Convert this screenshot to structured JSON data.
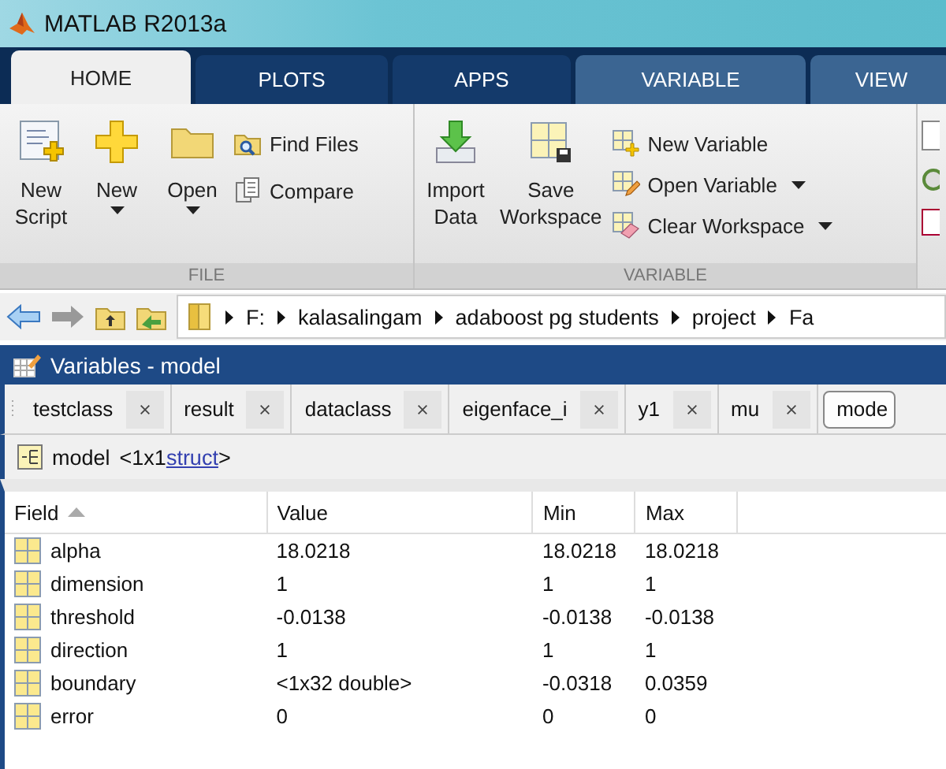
{
  "window": {
    "title": "MATLAB R2013a"
  },
  "tabs": [
    {
      "label": "HOME",
      "selected": true,
      "kind": "standard"
    },
    {
      "label": "PLOTS",
      "selected": false,
      "kind": "standard"
    },
    {
      "label": "APPS",
      "selected": false,
      "kind": "standard"
    },
    {
      "label": "VARIABLE",
      "selected": false,
      "kind": "contextual"
    },
    {
      "label": "VIEW",
      "selected": false,
      "kind": "contextual"
    }
  ],
  "ribbon": {
    "sections": [
      {
        "label": "FILE",
        "items": [
          {
            "kind": "large",
            "label": "New Script",
            "dropdown": false
          },
          {
            "kind": "large",
            "label": "New",
            "dropdown": true
          },
          {
            "kind": "large",
            "label": "Open",
            "dropdown": true
          },
          {
            "kind": "small",
            "label": "Find Files",
            "dropdown": false
          },
          {
            "kind": "small",
            "label": "Compare",
            "dropdown": false
          }
        ]
      },
      {
        "label": "VARIABLE",
        "items": [
          {
            "kind": "large",
            "label": "Import Data",
            "dropdown": false
          },
          {
            "kind": "large",
            "label": "Save Workspace",
            "dropdown": false
          },
          {
            "kind": "small",
            "label": "New Variable",
            "dropdown": false
          },
          {
            "kind": "small",
            "label": "Open Variable",
            "dropdown": true
          },
          {
            "kind": "small",
            "label": "Clear Workspace",
            "dropdown": true
          }
        ]
      }
    ]
  },
  "address_bar": {
    "path": [
      "F:",
      "kalasalingam",
      "adaboost pg students",
      "project",
      "Fa"
    ]
  },
  "variables_panel": {
    "title": "Variables - model",
    "doc_tabs": [
      {
        "label": "testclass",
        "selected": false
      },
      {
        "label": "result",
        "selected": false
      },
      {
        "label": "dataclass",
        "selected": false
      },
      {
        "label": "eigenface_i",
        "selected": false
      },
      {
        "label": "y1",
        "selected": false
      },
      {
        "label": "mu",
        "selected": false
      },
      {
        "label": "mode",
        "selected": true
      }
    ],
    "variable_name": "model",
    "variable_size": "<1x1",
    "variable_class": "struct",
    "variable_close": ">",
    "table": {
      "columns": [
        {
          "label": "Field",
          "sorted": true
        },
        {
          "label": "Value",
          "sorted": false
        },
        {
          "label": "Min",
          "sorted": false
        },
        {
          "label": "Max",
          "sorted": false
        }
      ],
      "rows": [
        [
          "alpha",
          "18.0218",
          "18.0218",
          "18.0218"
        ],
        [
          "dimension",
          "1",
          "1",
          "1"
        ],
        [
          "threshold",
          "-0.0138",
          "-0.0138",
          "-0.0138"
        ],
        [
          "direction",
          "1",
          "1",
          "1"
        ],
        [
          "boundary",
          "<1x32 double>",
          "-0.0318",
          "0.0359"
        ],
        [
          "error",
          "0",
          "0",
          "0"
        ]
      ]
    }
  }
}
